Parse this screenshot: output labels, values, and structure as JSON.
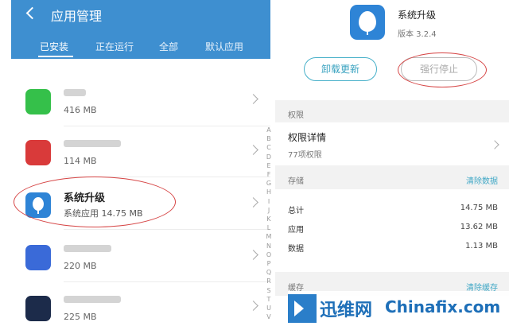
{
  "left": {
    "title": "应用管理",
    "tabs": [
      {
        "label": "已安装",
        "active": true
      },
      {
        "label": "正在运行",
        "active": false
      },
      {
        "label": "全部",
        "active": false
      },
      {
        "label": "默认应用",
        "active": false
      }
    ],
    "apps": [
      {
        "name": "",
        "size": "416 MB",
        "icon": "green-blurred-app-icon",
        "color": "#35c04a"
      },
      {
        "name": "",
        "size": "114 MB",
        "icon": "red-blurred-app-icon",
        "color": "#d93a3a"
      },
      {
        "name": "系统升级",
        "size": "系统应用   14.75 MB",
        "icon": "system-update-icon",
        "color": "#2e84d6"
      },
      {
        "name": "",
        "size": "220 MB",
        "icon": "blue-blurred-app-icon",
        "color": "#3a6ad8"
      },
      {
        "name": "",
        "size": "225 MB",
        "icon": "dark-blurred-app-icon",
        "color": "#1c2b4a"
      }
    ],
    "alphabet": [
      "A",
      "B",
      "C",
      "D",
      "E",
      "F",
      "G",
      "H",
      "I",
      "J",
      "K",
      "L",
      "M",
      "N",
      "O",
      "P",
      "Q",
      "R",
      "S",
      "T",
      "U",
      "V"
    ]
  },
  "right": {
    "app_name": "系统升级",
    "version": "版本 3.2.4",
    "uninstall_updates": "卸载更新",
    "force_stop": "强行停止",
    "permissions_header": "权限",
    "permission_details": "权限详情",
    "permission_count": "77项权限",
    "storage_header": "存储",
    "clear_data": "清除数据",
    "storage": [
      {
        "label": "总计",
        "value": "14.75 MB"
      },
      {
        "label": "应用",
        "value": "13.62 MB"
      },
      {
        "label": "数据",
        "value": "1.13 MB"
      }
    ],
    "cache_header": "缓存",
    "clear_cache": "清除缓存"
  },
  "watermark": {
    "cn": "迅维网",
    "en": "Chinafix.com"
  }
}
